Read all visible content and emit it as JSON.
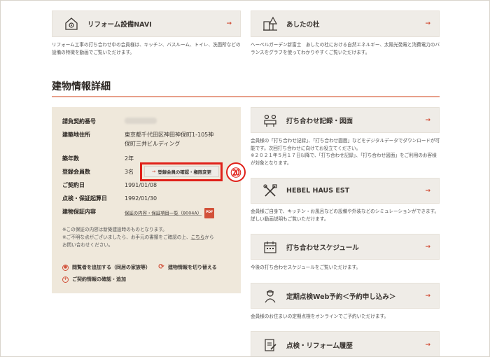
{
  "top_cards": [
    {
      "label": "リフォーム設備NAVI",
      "icon": "house-gear-icon",
      "desc": "リフォーム工事の打ち合わせ中の会員様は、キッチン、バスルーム、トイレ、洗面所などの設備の特徴を動画でご覧いただけます。"
    },
    {
      "label": "あしたの杜",
      "icon": "building-tree-icon",
      "desc": "ヘーベルガーデン新富士　あしたの杜における自然エネルギー、太陽光発電と消費電力のバランスをグラフを使ってわかりやすくご覧いただけます。"
    }
  ],
  "section": {
    "title": "建物情報詳細"
  },
  "info": {
    "contract_label": "請負契約番号",
    "address_label": "建築地住所",
    "address_line1": "東京都千代田区神田神保町1-105神",
    "address_line2": "保町三井ビルディング",
    "years_label": "築年数",
    "years_value": "2年",
    "members_label": "登録会員数",
    "members_value": "3名",
    "confirm_button": "登録会員の確認・権限変更",
    "contract_date_label": "ご契約日",
    "contract_date_value": "1991/01/08",
    "inspection_label": "点検・保証起算日",
    "inspection_value": "1992/01/30",
    "warranty_label": "建物保証内容",
    "warranty_link": "保証の内容・保証項目一覧（8004A）",
    "pdf": "PDF",
    "note1": "※この保証の内容は新築建設時のものとなります。",
    "note2a": "※ご不明な点がございましたら、お手元の書類をご確認の上、",
    "note2_link": "こちら",
    "note2b": "から",
    "note3": "お問い合わせください。",
    "action_add_viewer": "閲覧者を追加する（同居の家族等）",
    "action_switch": "建物情報を切り替える",
    "action_contract": "ご契約情報の確認・追加"
  },
  "annotation": {
    "number": "⑳",
    "color": "#e02019"
  },
  "right_cards": [
    {
      "label": "打ち合わせ記録・図面",
      "icon": "meeting-icon",
      "desc": [
        "会員様の「打ち合わせ記録」、「打ち合わせ図面」などをデジタルデータでダウンロードが可能です。次回打ち合わせに向けてお役立てください。",
        "※２０２１年５月１７日以降で、「打ち合わせ記録」、「打ち合わせ図面」をご利用のお客様が対象となります。"
      ]
    },
    {
      "label": "HEBEL HAUS EST",
      "icon": "tools-icon",
      "desc": [
        "会員様ご自身で、キッチン・お風呂などの設備や外装などのシミュレーションができます。詳しい動画説明もご覧いただけます。"
      ]
    },
    {
      "label": "打ち合わせスケジュール",
      "icon": "calendar-icon",
      "desc": [
        "今後の打ち合わせスケジュールをご覧いただけます。"
      ]
    },
    {
      "label": "定期点検Web予約＜予約申し込み＞",
      "icon": "inspector-icon",
      "desc": [
        "会員様のお住まいの定期点検をオンラインでご予約いただけます。"
      ]
    },
    {
      "label": "点検・リフォーム履歴",
      "icon": "document-edit-icon",
      "desc": []
    }
  ],
  "colors": {
    "accent": "#d2513a",
    "panel": "#efe8db",
    "card": "#efece7"
  }
}
